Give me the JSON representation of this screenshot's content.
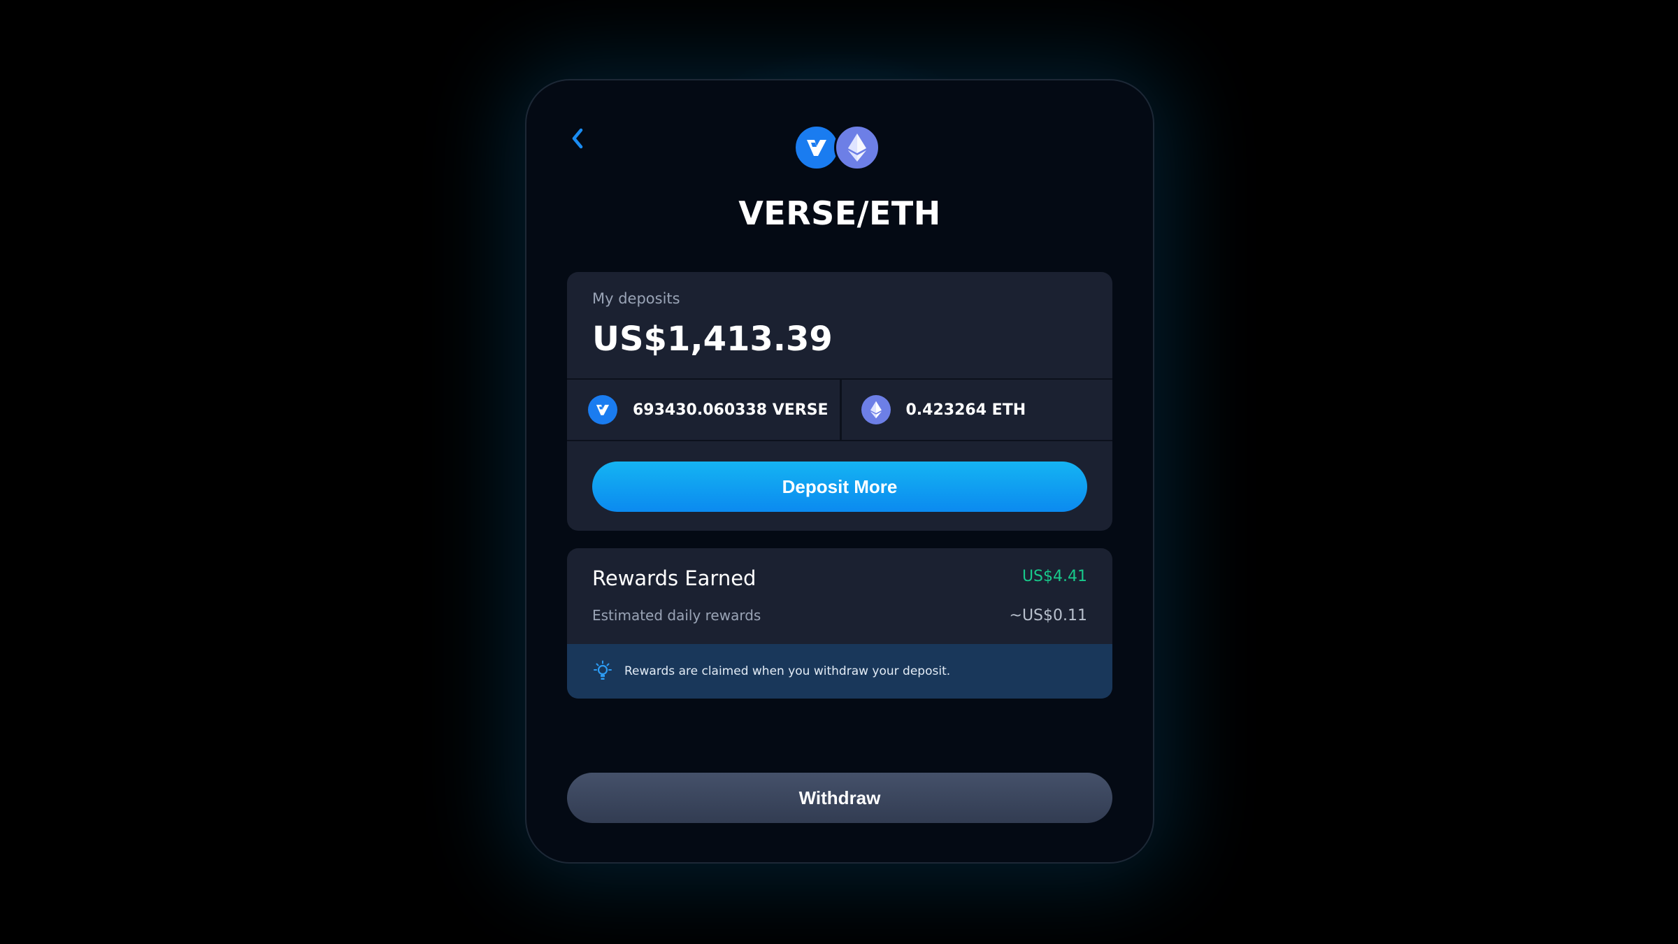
{
  "header": {
    "back_icon": "chevron-left-icon",
    "title": "VERSE/ETH",
    "token_icons": [
      "verse-logo-icon",
      "ethereum-logo-icon"
    ]
  },
  "deposits": {
    "label": "My deposits",
    "value": "US$1,413.39",
    "tokens": [
      {
        "icon": "verse-logo-icon",
        "amount": "693430.060338 VERSE"
      },
      {
        "icon": "ethereum-logo-icon",
        "amount": "0.423264 ETH"
      }
    ],
    "deposit_button_label": "Deposit More"
  },
  "rewards": {
    "title": "Rewards Earned",
    "value": "US$4.41",
    "estimated_label": "Estimated daily rewards",
    "estimated_value": "~US$0.11",
    "note_icon": "lightbulb-icon",
    "note": "Rewards are claimed when you withdraw your deposit."
  },
  "withdraw_button_label": "Withdraw",
  "colors": {
    "accent_blue": "#0b8af0",
    "rewards_green": "#18c98b",
    "panel": "#1b2131",
    "note_background": "#19375a"
  }
}
